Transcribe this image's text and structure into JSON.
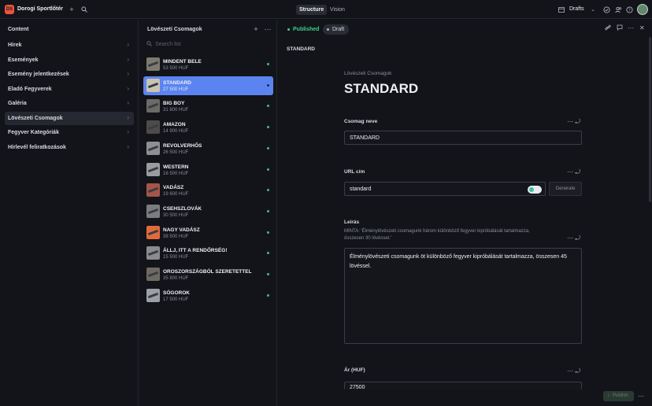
{
  "app": {
    "logo_text": "DS",
    "brand": "Dorogi Sportlőtér"
  },
  "topbar": {
    "tools": [
      "Structure",
      "Vision"
    ],
    "workspace": "Drafts"
  },
  "content_pane": {
    "title": "Content",
    "items": [
      {
        "label": "Hírek",
        "selected": false
      },
      {
        "label": "Események",
        "selected": false
      },
      {
        "label": "Esemény jelentkezések",
        "selected": false
      },
      {
        "label": "Eladó Fegyverek",
        "selected": false
      },
      {
        "label": "Galéria",
        "selected": false
      },
      {
        "label": "Lövészeti Csomagok",
        "selected": true
      },
      {
        "label": "Fegyver Kategóriák",
        "selected": false
      },
      {
        "label": "Hírlevél feliratkozások",
        "selected": false
      }
    ]
  },
  "list_pane": {
    "title": "Lövészeti Csomagok",
    "search_placeholder": "Search list",
    "documents": [
      {
        "title": "MINDENT BELE",
        "subtitle": "53 500 HUF",
        "selected": false
      },
      {
        "title": "STANDARD",
        "subtitle": "27 500 HUF",
        "selected": true
      },
      {
        "title": "BIG BOY",
        "subtitle": "31 800 HUF",
        "selected": false
      },
      {
        "title": "AMAZON",
        "subtitle": "14 900 HUF",
        "selected": false
      },
      {
        "title": "REVOLVERHŐS",
        "subtitle": "26 500 HUF",
        "selected": false
      },
      {
        "title": "WESTERN",
        "subtitle": "16 500 HUF",
        "selected": false
      },
      {
        "title": "VADÁSZ",
        "subtitle": "19 600 HUF",
        "selected": false
      },
      {
        "title": "CSEHSZLOVÁK",
        "subtitle": "30 500 HUF",
        "selected": false
      },
      {
        "title": "NAGY VADÁSZ",
        "subtitle": "38 500 HUF",
        "selected": false
      },
      {
        "title": "ÁLLJ, ITT A RENDŐRSÉG!",
        "subtitle": "15 500 HUF",
        "selected": false
      },
      {
        "title": "OROSZORSZÁGBÓL SZERETETTEL",
        "subtitle": "35 800 HUF",
        "selected": false
      },
      {
        "title": "SÓGOROK",
        "subtitle": "17 500 HUF",
        "selected": false
      }
    ]
  },
  "document": {
    "status_published": "Published",
    "status_draft": "Draft",
    "tab_title": "STANDARD",
    "breadcrumb": "Lövészeti Csomagok",
    "title": "STANDARD",
    "fields": {
      "name": {
        "label": "Csomag neve",
        "value": "STANDARD"
      },
      "slug": {
        "label": "URL cím",
        "value": "standard",
        "generate_label": "Generate"
      },
      "description": {
        "label": "Leírás",
        "hint": "MINTA: 'Élménylövészeti csomagunk három különböző fegyver kipróbálását tartalmazza, összesen 30 lövéssel.'",
        "value": "Élménylövészeti csomagunk öt különböző fegyver kipróbálását tartalmazza, összesen 45 lövéssel."
      },
      "price": {
        "label": "Ár (HUF)",
        "value": "27500"
      }
    },
    "publish_label": "Publish"
  }
}
